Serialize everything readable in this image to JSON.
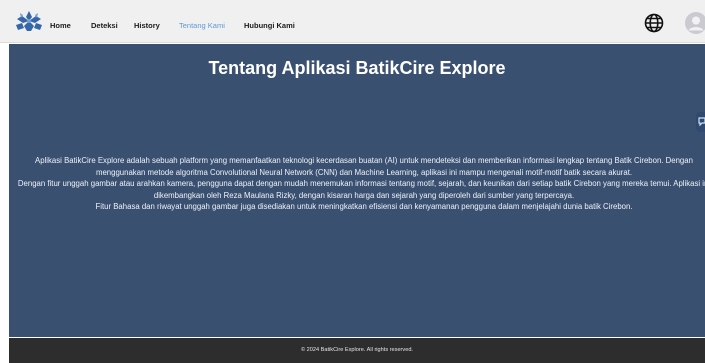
{
  "nav": {
    "logo_icon": "batik-logo-icon",
    "links": [
      {
        "label": "Home",
        "active": false
      },
      {
        "label": "Deteksi",
        "active": false
      },
      {
        "label": "History",
        "active": false
      },
      {
        "label": "Tentang Kami",
        "active": true
      },
      {
        "label": "Hubungi Kami",
        "active": false
      }
    ],
    "language_icon": "globe-icon",
    "profile_icon": "user-avatar-icon"
  },
  "main": {
    "title": "Tentang Aplikasi BatikCire Explore",
    "side_tab_icon": "chat-icon",
    "paragraphs": [
      "Aplikasi BatikCire Explore adalah sebuah platform yang memanfaatkan teknologi kecerdasan buatan (AI) untuk mendeteksi dan memberikan informasi lengkap tentang Batik Cirebon. Dengan menggunakan metode algoritma Convolutional Neural Network (CNN) dan Machine Learning, aplikasi ini mampu mengenali motif-motif batik secara akurat.",
      "Dengan fitur unggah gambar atau arahkan kamera, pengguna dapat dengan mudah menemukan informasi tentang motif, sejarah, dan keunikan dari setiap batik Cirebon yang mereka temui. Aplikasi ini dikembangkan oleh Reza Maulana Rizky, dengan kisaran harga dan sejarah yang diperoleh dari sumber yang terpercaya.",
      "Fitur Bahasa dan riwayat unggah gambar juga disediakan untuk meningkatkan efisiensi dan kenyamanan pengguna dalam menjelajahi dunia batik Cirebon."
    ]
  },
  "footer": {
    "text": "© 2024 BatikCire Explore. All rights reserved."
  },
  "colors": {
    "navbar_bg": "#f0f0f1",
    "main_bg": "#3a5071",
    "footer_bg": "#2d2d2d",
    "active_link": "#5a9ad8",
    "logo_blue": "#3566a8"
  }
}
